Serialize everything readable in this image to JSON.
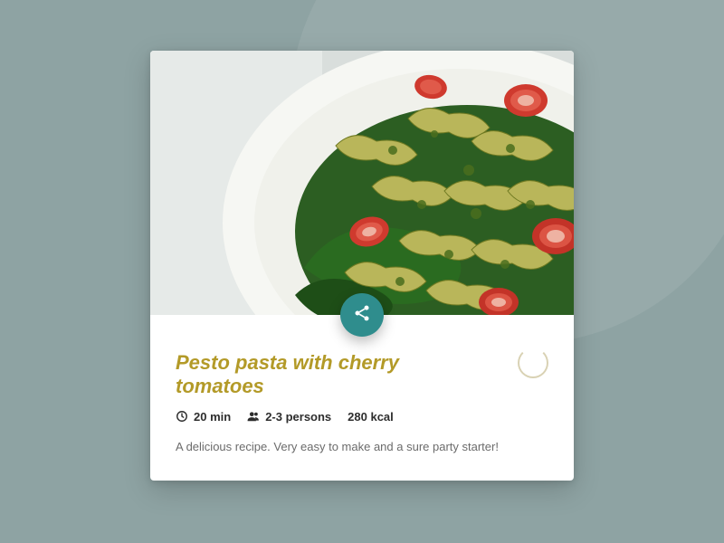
{
  "recipe": {
    "title": "Pesto pasta with cherry tomatoes",
    "time": "20 min",
    "servings": "2-3 persons",
    "calories": "280 kcal",
    "description": "A delicious recipe. Very easy to make and a sure party starter!"
  },
  "icons": {
    "fab": "share-icon",
    "time": "clock-icon",
    "servings": "users-icon"
  },
  "colors": {
    "accent": "#b39a28",
    "fab": "#2f8d8d",
    "background": "#8ea3a3"
  }
}
